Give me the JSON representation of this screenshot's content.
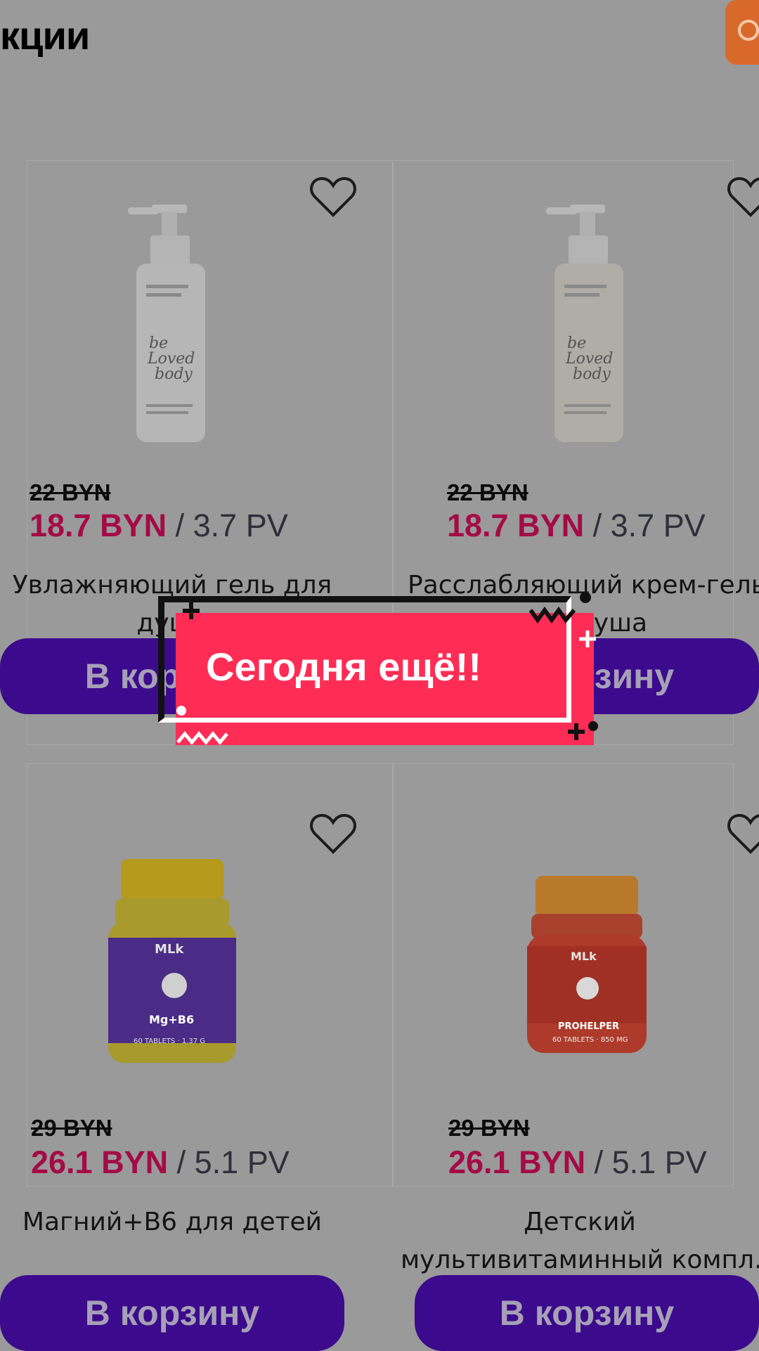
{
  "header": {
    "title": "кции"
  },
  "products": [
    {
      "old_price": "22 BYN",
      "new_price": "18.7 BYN",
      "separator": "/",
      "pv": "3.7 PV",
      "name_line1": "Увлажняющий гель для",
      "name_line2": "душа",
      "cart_label": "В корзину",
      "image": "shower-gel-bottle"
    },
    {
      "old_price": "22 BYN",
      "new_price": "18.7 BYN",
      "separator": "/",
      "pv": "3.7 PV",
      "name_line1": "Расслабляющий крем-гель",
      "name_line2": "для душа",
      "cart_label": "В корзину",
      "image": "shower-cream-bottle"
    },
    {
      "old_price": "29 BYN",
      "new_price": "26.1 BYN",
      "separator": "/",
      "pv": "5.1 PV",
      "name_line1": "Магний+B6 для детей",
      "name_line2": "",
      "cart_label": "В корзину",
      "image": "vitamin-jar-yellow"
    },
    {
      "old_price": "29 BYN",
      "new_price": "26.1 BYN",
      "separator": "/",
      "pv": "5.1 PV",
      "name_line1": "Детский",
      "name_line2": "мультивитаминный компл...",
      "cart_label": "В корзину",
      "image": "vitamin-jar-red"
    }
  ],
  "overlay": {
    "banner_text": "Сегодня ещё!!"
  },
  "colors": {
    "background_dim": "#9a9a9a",
    "price": "#a40b46",
    "cart_button": "#3c0a8c",
    "banner": "#ff2d55",
    "share_button": "#d9692b"
  }
}
